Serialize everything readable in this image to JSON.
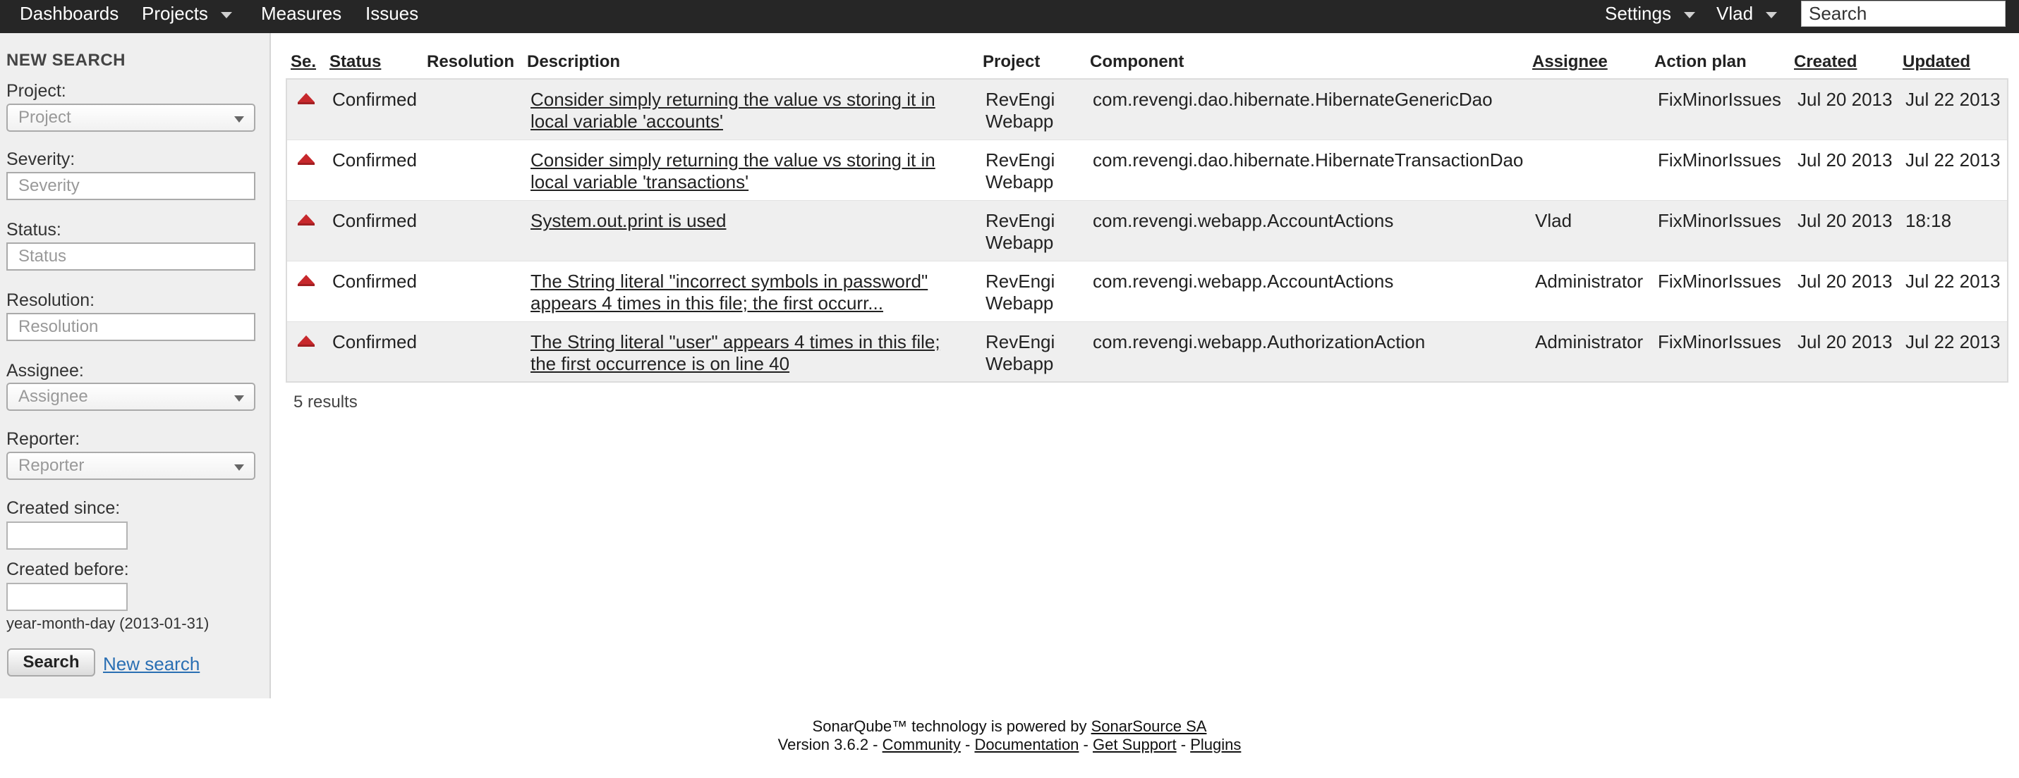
{
  "nav": {
    "dashboards": "Dashboards",
    "projects": "Projects",
    "measures": "Measures",
    "issues": "Issues",
    "settings": "Settings",
    "user": "Vlad",
    "search_placeholder": "Search"
  },
  "sidebar": {
    "title": "NEW SEARCH",
    "project_label": "Project:",
    "project_placeholder": "Project",
    "severity_label": "Severity:",
    "severity_placeholder": "Severity",
    "status_label": "Status:",
    "status_placeholder": "Status",
    "resolution_label": "Resolution:",
    "resolution_placeholder": "Resolution",
    "assignee_label": "Assignee:",
    "assignee_placeholder": "Assignee",
    "reporter_label": "Reporter:",
    "reporter_placeholder": "Reporter",
    "created_since_label": "Created since:",
    "created_before_label": "Created before:",
    "date_hint": "year-month-day (2013-01-31)",
    "search_button": "Search",
    "new_search_link": "New search"
  },
  "table": {
    "headers": {
      "severity": "Se.",
      "status": "Status",
      "resolution": "Resolution",
      "description": "Description",
      "project": "Project",
      "component": "Component",
      "assignee": "Assignee",
      "action_plan": "Action plan",
      "created": "Created",
      "updated": "Updated"
    },
    "rows": [
      {
        "severity_icon": "major-severity-icon",
        "status": "Confirmed",
        "resolution": "",
        "description": "Consider simply returning the value vs storing it in local variable 'accounts'",
        "project": "RevEngi Webapp",
        "component": "com.revengi.dao.hibernate.HibernateGenericDao",
        "assignee": "",
        "action_plan": "FixMinorIssues",
        "created": "Jul 20 2013",
        "updated": "Jul 22 2013"
      },
      {
        "severity_icon": "major-severity-icon",
        "status": "Confirmed",
        "resolution": "",
        "description": "Consider simply returning the value vs storing it in local variable 'transactions'",
        "project": "RevEngi Webapp",
        "component": "com.revengi.dao.hibernate.HibernateTransactionDao",
        "assignee": "",
        "action_plan": "FixMinorIssues",
        "created": "Jul 20 2013",
        "updated": "Jul 22 2013"
      },
      {
        "severity_icon": "major-severity-icon",
        "status": "Confirmed",
        "resolution": "",
        "description": "System.out.print is used",
        "project": "RevEngi Webapp",
        "component": "com.revengi.webapp.AccountActions",
        "assignee": "Vlad",
        "action_plan": "FixMinorIssues",
        "created": "Jul 20 2013",
        "updated": "18:18"
      },
      {
        "severity_icon": "major-severity-icon",
        "status": "Confirmed",
        "resolution": "",
        "description": "The String literal \"incorrect symbols in password\" appears 4 times in this file; the first occurr...",
        "project": "RevEngi Webapp",
        "component": "com.revengi.webapp.AccountActions",
        "assignee": "Administrator",
        "action_plan": "FixMinorIssues",
        "created": "Jul 20 2013",
        "updated": "Jul 22 2013"
      },
      {
        "severity_icon": "major-severity-icon",
        "status": "Confirmed",
        "resolution": "",
        "description": "The String literal \"user\" appears 4 times in this file; the first occurrence is on line 40",
        "project": "RevEngi Webapp",
        "component": "com.revengi.webapp.AuthorizationAction",
        "assignee": "Administrator",
        "action_plan": "FixMinorIssues",
        "created": "Jul 20 2013",
        "updated": "Jul 22 2013"
      }
    ],
    "results_text": "5 results"
  },
  "footer": {
    "line1_prefix": "SonarQube™ technology is powered by ",
    "sonarsource_link": "SonarSource SA",
    "version_prefix": "Version 3.6.2 - ",
    "community_link": "Community",
    "documentation_link": "Documentation",
    "support_link": "Get Support",
    "plugins_link": "Plugins",
    "separator": " - "
  },
  "colors": {
    "nav_bg": "#262626",
    "sidebar_bg": "#efefef",
    "row_alt_bg": "#efefef",
    "severity_major": "#c7282c",
    "link_blue": "#2a6fb3"
  }
}
